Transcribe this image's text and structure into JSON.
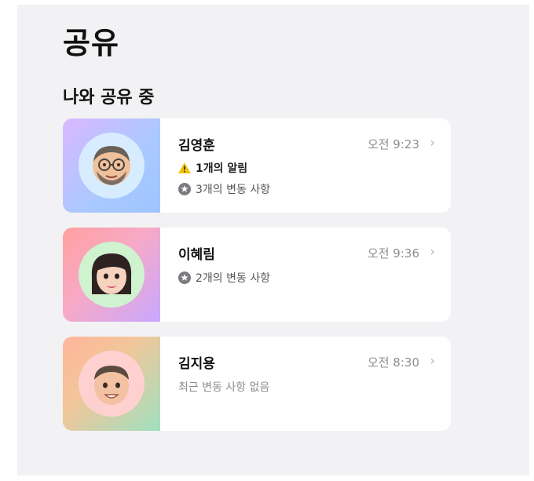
{
  "page_title": "공유",
  "section_title": "나와 공유 중",
  "people": [
    {
      "name": "김영훈",
      "time": "오전 9:23",
      "alert": "1개의 알림",
      "changes": "3개의 변동 사항",
      "gradient": [
        "#cdb6ff",
        "#9ec4ff"
      ],
      "ring": "#d7ecff"
    },
    {
      "name": "이혜림",
      "time": "오전 9:36",
      "changes": "2개의 변동 사항",
      "gradient": [
        "#ffa5a0",
        "#c8a8ff"
      ],
      "ring": "#cff2cf"
    },
    {
      "name": "김지용",
      "time": "오전 8:30",
      "status": "최근 변동 사항 없음",
      "gradient": [
        "#ffb99a",
        "#9fe0c0"
      ],
      "ring": "#ffd0d0"
    }
  ],
  "icons": {
    "alert": "warning-triangle-icon",
    "change": "circle-star-icon",
    "chevron": "chevron-right-icon"
  }
}
